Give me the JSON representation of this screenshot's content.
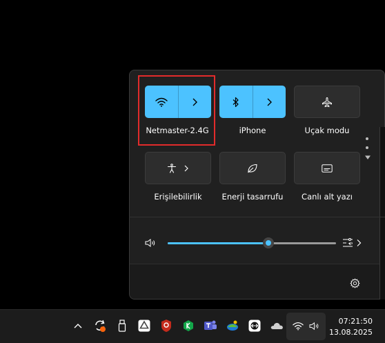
{
  "quick_settings": {
    "tiles": [
      {
        "name": "wifi",
        "label": "Netmaster-2.4G",
        "state": "on",
        "icon": "wifi-icon"
      },
      {
        "name": "bluetooth",
        "label": "iPhone",
        "state": "on",
        "icon": "bluetooth-icon"
      },
      {
        "name": "airplane",
        "label": "Uçak modu",
        "state": "off",
        "icon": "airplane-icon"
      },
      {
        "name": "accessibility",
        "label": "Erişilebilirlik",
        "state": "off",
        "icon": "accessibility-icon"
      },
      {
        "name": "energy",
        "label": "Enerji tasarrufu",
        "state": "off",
        "icon": "leaf-icon"
      },
      {
        "name": "captions",
        "label": "Canlı alt yazı",
        "state": "off",
        "icon": "captions-icon"
      }
    ],
    "volume": {
      "level": 0.6
    },
    "accent_color": "#4cc2ff"
  },
  "taskbar": {
    "clock": {
      "time": "07:21:50",
      "date": "13.08.2025"
    }
  }
}
